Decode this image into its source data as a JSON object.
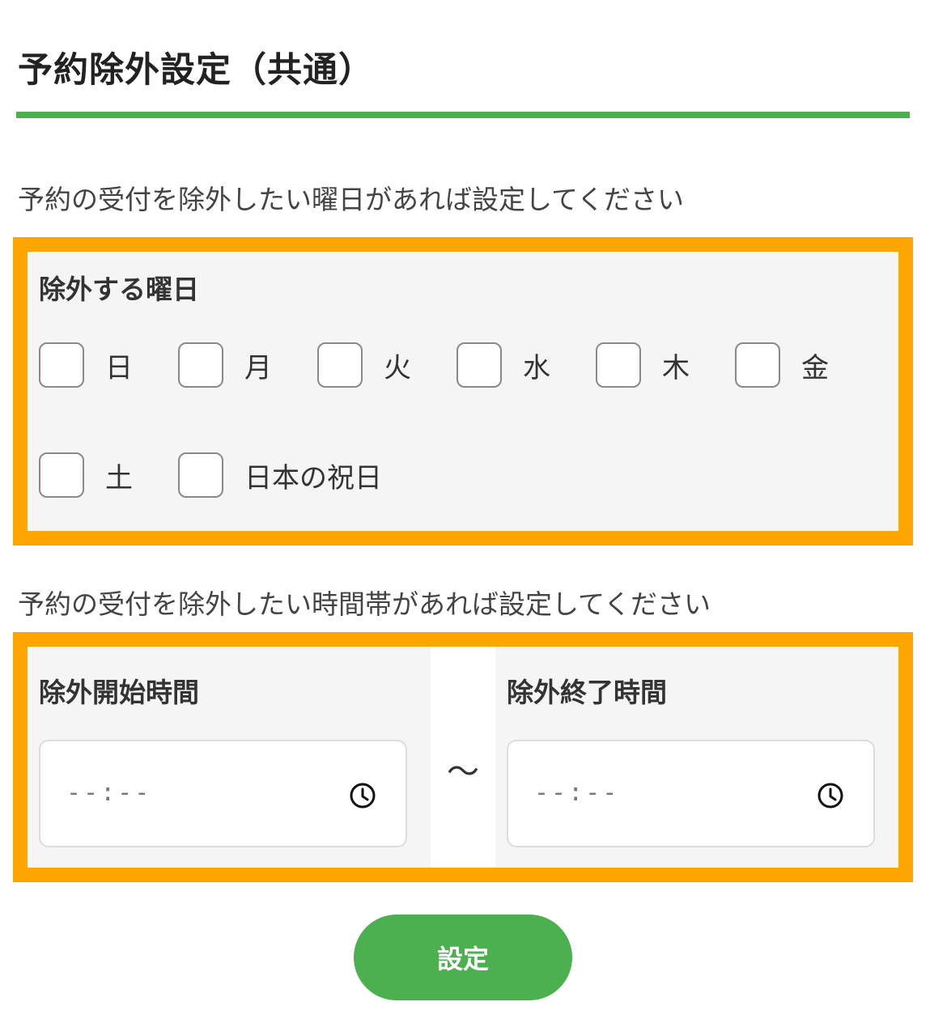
{
  "page": {
    "title": "予約除外設定（共通）"
  },
  "days_section": {
    "instruction": "予約の受付を除外したい曜日があれば設定してください",
    "label": "除外する曜日",
    "options": [
      {
        "label": "日",
        "checked": false
      },
      {
        "label": "月",
        "checked": false
      },
      {
        "label": "火",
        "checked": false
      },
      {
        "label": "水",
        "checked": false
      },
      {
        "label": "木",
        "checked": false
      },
      {
        "label": "金",
        "checked": false
      },
      {
        "label": "土",
        "checked": false
      },
      {
        "label": "日本の祝日",
        "checked": false
      }
    ]
  },
  "time_section": {
    "instruction": "予約の受付を除外したい時間帯があれば設定してください",
    "separator": "〜",
    "start": {
      "label": "除外開始時間",
      "placeholder": "--:--",
      "value": "",
      "icon": "clock-icon"
    },
    "end": {
      "label": "除外終了時間",
      "placeholder": "--:--",
      "value": "",
      "icon": "clock-icon"
    }
  },
  "actions": {
    "submit_label": "設定"
  },
  "colors": {
    "accent_green": "#4caf50",
    "highlight_orange": "#ffa600",
    "panel_background": "#f5f5f5"
  }
}
